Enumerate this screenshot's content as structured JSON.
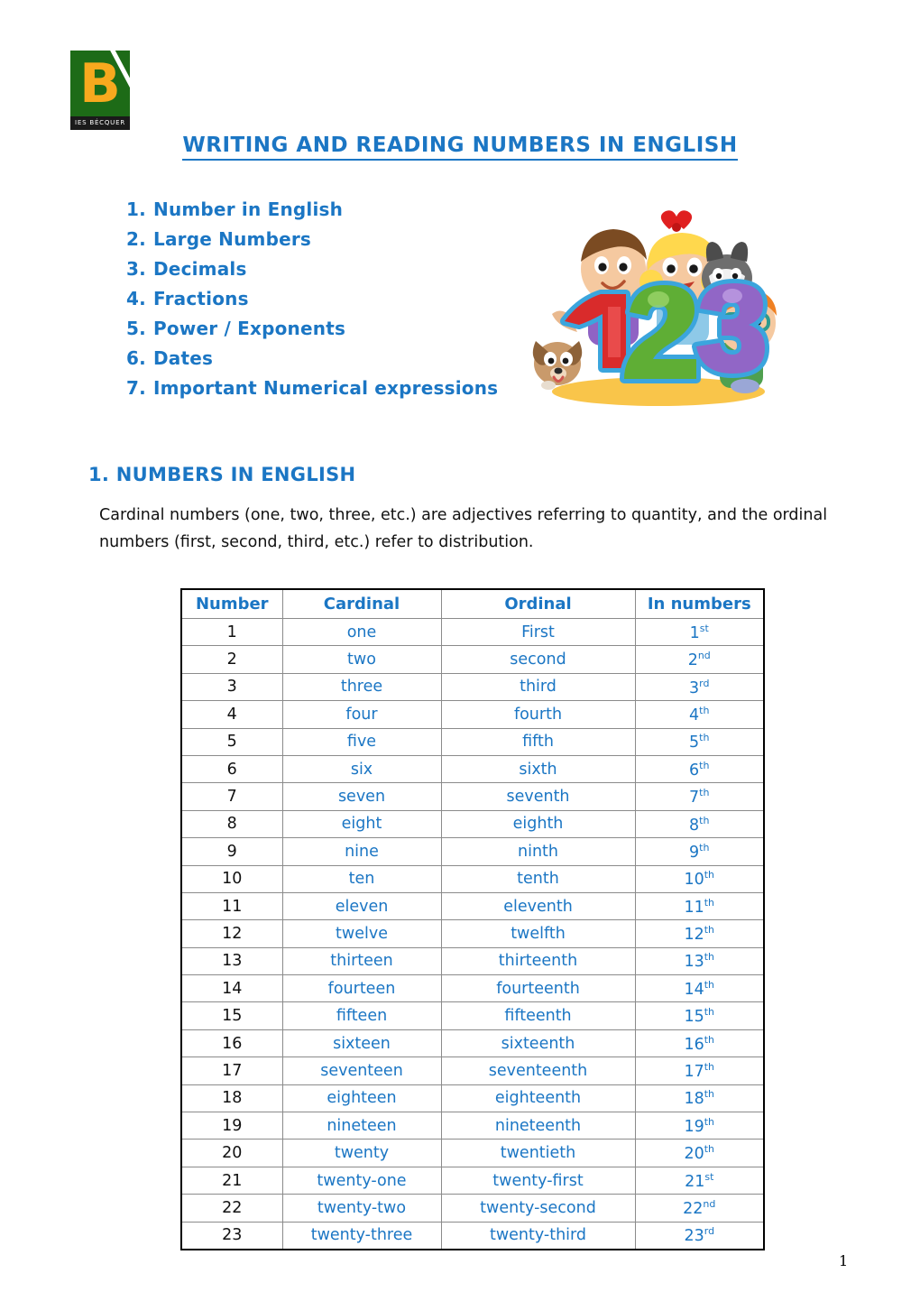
{
  "logo": {
    "letter": "B",
    "institution": "IES  BÉCQUER"
  },
  "colors": {
    "accent_blue": "#1b76c4",
    "logo_green": "#1d6b17",
    "logo_orange": "#f7a91e",
    "table_border": "#8b8b8b",
    "text_black": "#111111"
  },
  "title": "WRITING AND READING NUMBERS IN ENGLISH",
  "toc": {
    "items": [
      {
        "num": "1.",
        "label": "Number in English"
      },
      {
        "num": "2.",
        "label": "Large Numbers"
      },
      {
        "num": "3.",
        "label": "Decimals"
      },
      {
        "num": "4.",
        "label": "Fractions"
      },
      {
        "num": "5.",
        "label": "Power / Exponents"
      },
      {
        "num": "6.",
        "label": "Dates"
      },
      {
        "num": "7.",
        "label": "Important Numerical expressions"
      }
    ]
  },
  "clipart": {
    "alt": "Cartoon children with large colourful numbers 1 2 3, a cat and a dog",
    "digits": [
      "1",
      "2",
      "3"
    ],
    "digit_colors": [
      "#d42a2a",
      "#5aa832",
      "#8f63c4"
    ]
  },
  "section": {
    "heading": "1. NUMBERS IN ENGLISH",
    "paragraph": "Cardinal numbers (one, two, three, etc.) are adjectives referring to quantity, and the ordinal numbers (first, second, third, etc.) refer to distribution."
  },
  "table": {
    "headers": [
      "Number",
      "Cardinal",
      "Ordinal",
      "In numbers"
    ],
    "rows": [
      {
        "number": "1",
        "cardinal": "one",
        "ordinal": "First",
        "in_numbers": "1",
        "suffix": "st"
      },
      {
        "number": "2",
        "cardinal": "two",
        "ordinal": "second",
        "in_numbers": "2",
        "suffix": "nd"
      },
      {
        "number": "3",
        "cardinal": "three",
        "ordinal": "third",
        "in_numbers": "3",
        "suffix": "rd"
      },
      {
        "number": "4",
        "cardinal": "four",
        "ordinal": "fourth",
        "in_numbers": "4",
        "suffix": "th"
      },
      {
        "number": "5",
        "cardinal": "five",
        "ordinal": "fifth",
        "in_numbers": "5",
        "suffix": "th"
      },
      {
        "number": "6",
        "cardinal": "six",
        "ordinal": "sixth",
        "in_numbers": "6",
        "suffix": "th"
      },
      {
        "number": "7",
        "cardinal": "seven",
        "ordinal": "seventh",
        "in_numbers": "7",
        "suffix": "th"
      },
      {
        "number": "8",
        "cardinal": "eight",
        "ordinal": "eighth",
        "in_numbers": "8",
        "suffix": "th"
      },
      {
        "number": "9",
        "cardinal": "nine",
        "ordinal": "ninth",
        "in_numbers": "9",
        "suffix": "th"
      },
      {
        "number": "10",
        "cardinal": "ten",
        "ordinal": "tenth",
        "in_numbers": "10",
        "suffix": "th"
      },
      {
        "number": "11",
        "cardinal": "eleven",
        "ordinal": "eleventh",
        "in_numbers": "11",
        "suffix": "th"
      },
      {
        "number": "12",
        "cardinal": "twelve",
        "ordinal": "twelfth",
        "in_numbers": "12",
        "suffix": "th"
      },
      {
        "number": "13",
        "cardinal": "thirteen",
        "ordinal": "thirteenth",
        "in_numbers": "13",
        "suffix": "th"
      },
      {
        "number": "14",
        "cardinal": "fourteen",
        "ordinal": "fourteenth",
        "in_numbers": "14",
        "suffix": "th"
      },
      {
        "number": "15",
        "cardinal": "fifteen",
        "ordinal": "fifteenth",
        "in_numbers": "15",
        "suffix": "th"
      },
      {
        "number": "16",
        "cardinal": "sixteen",
        "ordinal": "sixteenth",
        "in_numbers": "16",
        "suffix": "th"
      },
      {
        "number": "17",
        "cardinal": "seventeen",
        "ordinal": "seventeenth",
        "in_numbers": "17",
        "suffix": "th"
      },
      {
        "number": "18",
        "cardinal": "eighteen",
        "ordinal": "eighteenth",
        "in_numbers": "18",
        "suffix": "th"
      },
      {
        "number": "19",
        "cardinal": "nineteen",
        "ordinal": "nineteenth",
        "in_numbers": "19",
        "suffix": "th"
      },
      {
        "number": "20",
        "cardinal": "twenty",
        "ordinal": "twentieth",
        "in_numbers": "20",
        "suffix": "th"
      },
      {
        "number": "21",
        "cardinal": "twenty-one",
        "ordinal": "twenty-first",
        "in_numbers": "21",
        "suffix": "st"
      },
      {
        "number": "22",
        "cardinal": "twenty-two",
        "ordinal": "twenty-second",
        "in_numbers": "22",
        "suffix": "nd"
      },
      {
        "number": "23",
        "cardinal": "twenty-three",
        "ordinal": "twenty-third",
        "in_numbers": "23",
        "suffix": "rd"
      }
    ]
  },
  "footer": {
    "page_number": "1"
  }
}
